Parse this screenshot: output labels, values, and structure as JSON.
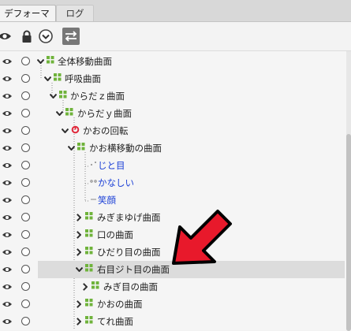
{
  "tabs": [
    {
      "label": "デフォーマ"
    },
    {
      "label": "ログ"
    }
  ],
  "toolbar": {
    "eye_icon": "eye-icon",
    "lock_icon": "lock-icon",
    "expand_icon": "chevron-circle-down-icon",
    "swap_icon": "swap-arrows-icon"
  },
  "tree": {
    "rows": [
      {
        "label": "全体移動曲面",
        "type": "curved"
      },
      {
        "label": "呼吸曲面",
        "type": "curved"
      },
      {
        "label": "からだｚ曲面",
        "type": "curved"
      },
      {
        "label": "からだｙ曲面",
        "type": "curved"
      },
      {
        "label": "かおの回転",
        "type": "rotation"
      },
      {
        "label": "かお横移動の曲面",
        "type": "curved"
      },
      {
        "label": "じと目",
        "type": "art-path"
      },
      {
        "label": "かなしい",
        "type": "art-path"
      },
      {
        "label": "笑顔",
        "type": "art-path"
      },
      {
        "label": "みぎまゆげ曲面",
        "type": "curved"
      },
      {
        "label": "口の曲面",
        "type": "curved"
      },
      {
        "label": "ひだり目の曲面",
        "type": "curved"
      },
      {
        "label": "右目ジト目の曲面",
        "type": "curved",
        "selected": true
      },
      {
        "label": "みぎ目の曲面",
        "type": "curved"
      },
      {
        "label": "かおの曲面",
        "type": "curved"
      },
      {
        "label": "てれ曲面",
        "type": "curved"
      }
    ]
  },
  "colors": {
    "deformer_green": "#6fb33b",
    "rotation_red": "#e0283a",
    "artpath_blue": "#1a3fd6",
    "arrow_red": "#e8192b",
    "selection": "#dcdcdc"
  }
}
